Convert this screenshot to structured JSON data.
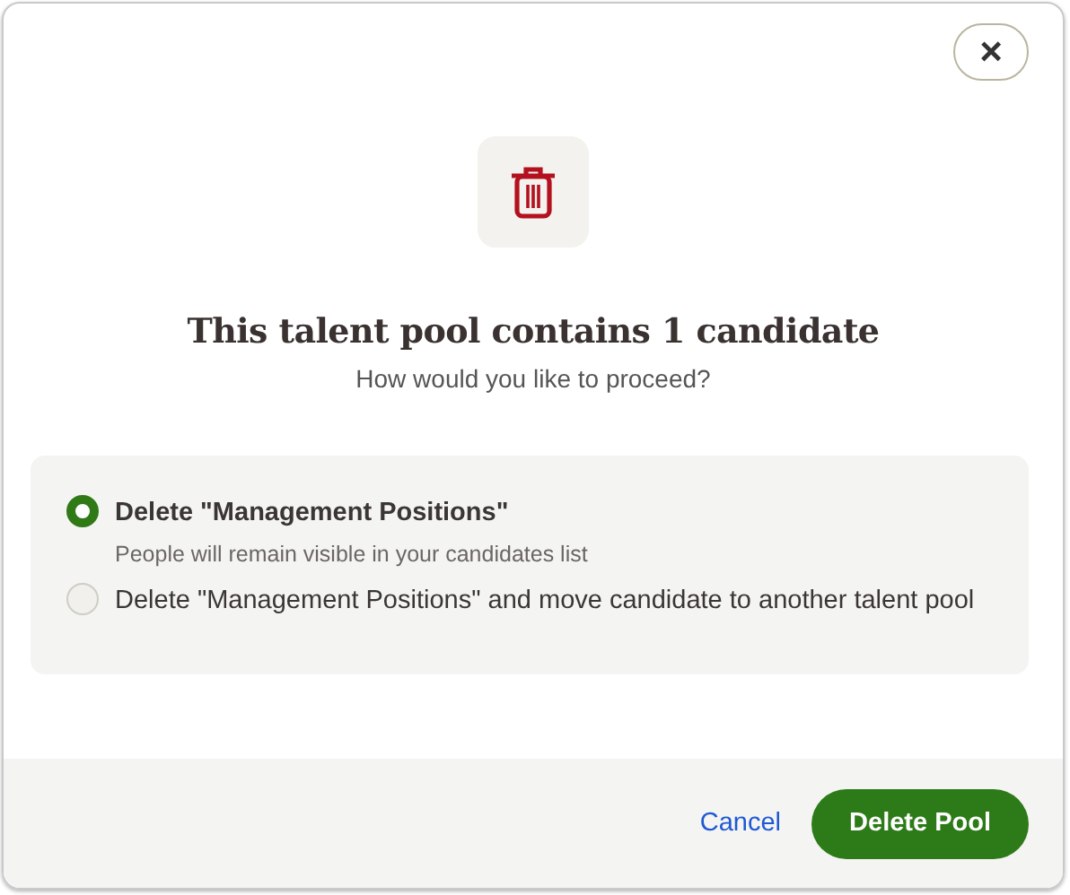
{
  "dialog": {
    "close_label": "×",
    "title": "This talent pool contains 1 candidate",
    "subtitle": "How would you like to proceed?",
    "options": [
      {
        "label": "Delete \"Management Positions\"",
        "description": "People will remain visible in your candidates list",
        "selected": true
      },
      {
        "label": "Delete \"Management Positions\" and move candidate to another talent pool",
        "selected": false
      }
    ],
    "buttons": {
      "cancel": "Cancel",
      "confirm": "Delete Pool"
    }
  }
}
